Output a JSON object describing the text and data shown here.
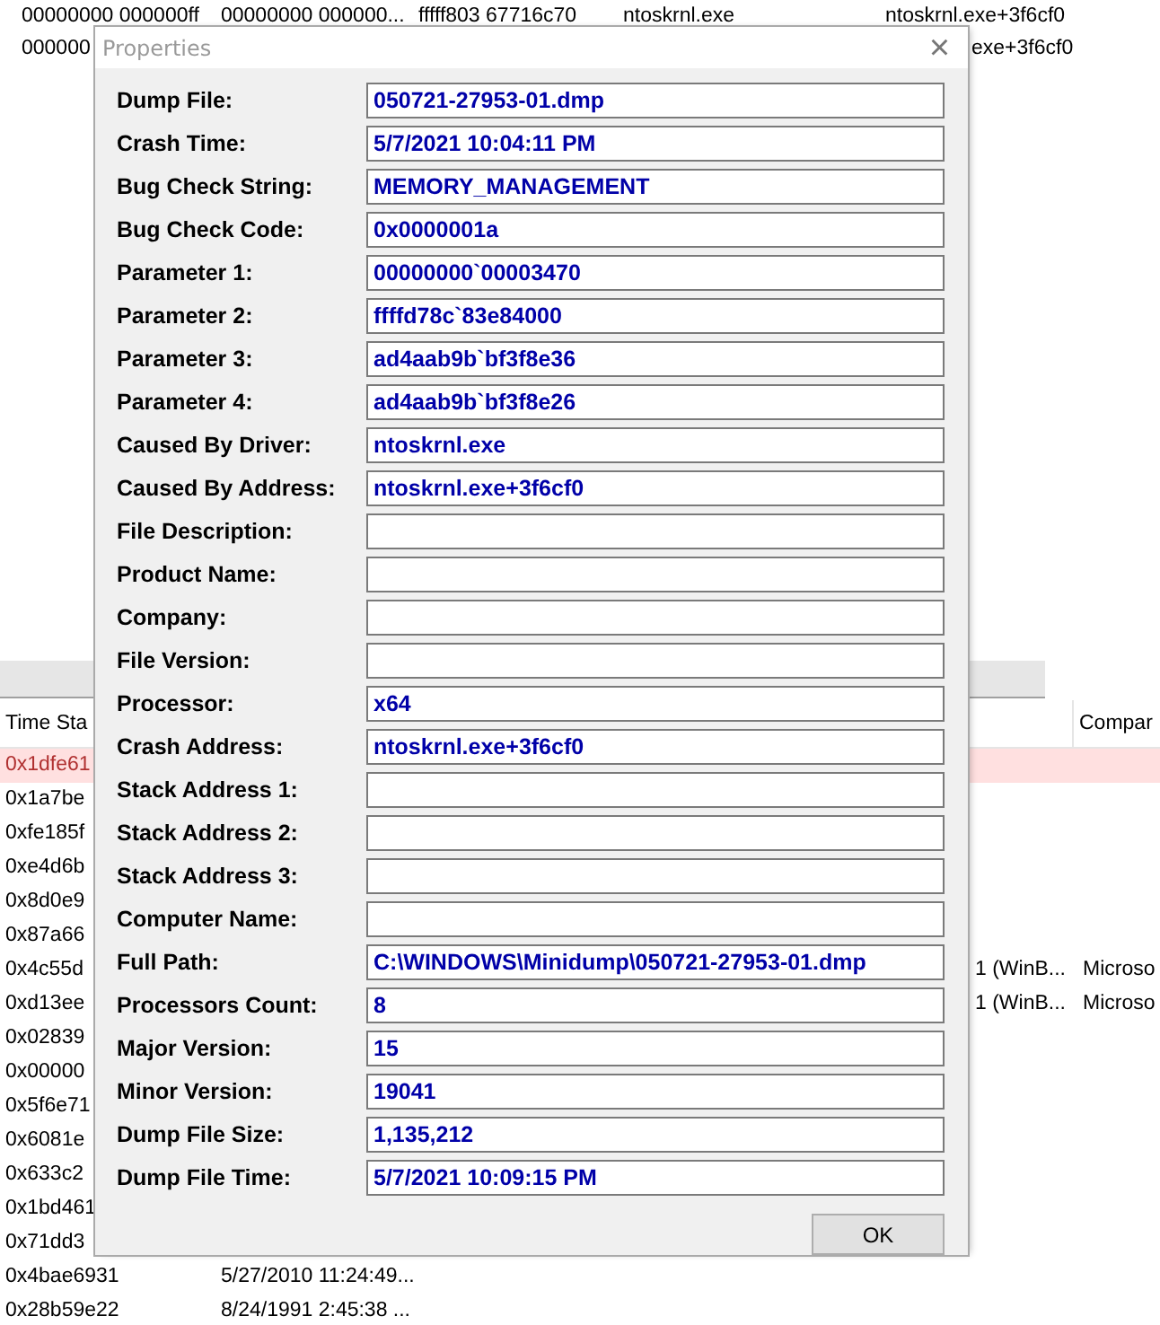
{
  "background_list": {
    "top_rows": [
      {
        "cells": [
          "00000000 000000ff",
          "00000000 000000...",
          "fffff803 67716c70",
          "ntoskrnl.exe",
          "ntoskrnl.exe+3f6cf0"
        ]
      },
      {
        "cells": [
          "000000",
          "",
          "",
          "",
          "exe+3f6cf0"
        ]
      }
    ],
    "table": {
      "visible_column_headers": [
        "Time Sta",
        "Compar"
      ],
      "rows": [
        {
          "cells": [
            "0x1dfe61",
            "",
            "",
            ""
          ],
          "selected": true
        },
        {
          "cells": [
            "0x1a7be",
            "",
            "",
            ""
          ],
          "selected": false
        },
        {
          "cells": [
            "0xfe185f",
            "",
            "",
            ""
          ],
          "selected": false
        },
        {
          "cells": [
            "0xe4d6b",
            "",
            "",
            ""
          ],
          "selected": false
        },
        {
          "cells": [
            "0x8d0e9",
            "",
            "",
            ""
          ],
          "selected": false
        },
        {
          "cells": [
            "0x87a66",
            "",
            "",
            ""
          ],
          "selected": false
        },
        {
          "cells": [
            "0x4c55d",
            "",
            "1 (WinB...",
            "Microso"
          ],
          "selected": false
        },
        {
          "cells": [
            "0xd13ee",
            "",
            "1 (WinB...",
            "Microso"
          ],
          "selected": false
        },
        {
          "cells": [
            "0x02839",
            "",
            "",
            ""
          ],
          "selected": false
        },
        {
          "cells": [
            "0x00000",
            "",
            "",
            ""
          ],
          "selected": false
        },
        {
          "cells": [
            "0x5f6e71",
            "",
            "",
            ""
          ],
          "selected": false
        },
        {
          "cells": [
            "0x6081e",
            "",
            "",
            ""
          ],
          "selected": false
        },
        {
          "cells": [
            "0x633c2",
            "",
            "",
            ""
          ],
          "selected": false
        },
        {
          "cells": [
            "0x1bd461",
            "",
            "",
            ""
          ],
          "selected": false
        },
        {
          "cells": [
            "0x71dd3",
            "",
            "",
            ""
          ],
          "selected": false
        },
        {
          "cells": [
            "0x4bae6931",
            "5/27/2010 11:24:49...",
            "",
            ""
          ],
          "selected": false
        },
        {
          "cells": [
            "0x28b59e22",
            "8/24/1991 2:45:38 ...",
            "",
            ""
          ],
          "selected": false
        }
      ]
    }
  },
  "dialog": {
    "title": "Properties",
    "close": "×",
    "fields": [
      {
        "label": "Dump File:",
        "value": "050721-27953-01.dmp"
      },
      {
        "label": "Crash Time:",
        "value": "5/7/2021 10:04:11 PM"
      },
      {
        "label": "Bug Check String:",
        "value": "MEMORY_MANAGEMENT"
      },
      {
        "label": "Bug Check Code:",
        "value": "0x0000001a"
      },
      {
        "label": "Parameter 1:",
        "value": "00000000`00003470"
      },
      {
        "label": "Parameter 2:",
        "value": "ffffd78c`83e84000"
      },
      {
        "label": "Parameter 3:",
        "value": "ad4aab9b`bf3f8e36"
      },
      {
        "label": "Parameter 4:",
        "value": "ad4aab9b`bf3f8e26"
      },
      {
        "label": "Caused By Driver:",
        "value": "ntoskrnl.exe"
      },
      {
        "label": "Caused By Address:",
        "value": "ntoskrnl.exe+3f6cf0"
      },
      {
        "label": "File Description:"
      },
      {
        "label": "Product Name:"
      },
      {
        "label": "Company:"
      },
      {
        "label": "File Version:"
      },
      {
        "label": "Processor:",
        "value": "x64"
      },
      {
        "label": "Crash Address:",
        "value": "ntoskrnl.exe+3f6cf0"
      },
      {
        "label": "Stack Address 1:"
      },
      {
        "label": "Stack Address 2:"
      },
      {
        "label": "Stack Address 3:"
      },
      {
        "label": "Computer Name:"
      },
      {
        "label": "Full Path:",
        "value": "C:\\WINDOWS\\Minidump\\050721-27953-01.dmp"
      },
      {
        "label": "Processors Count:",
        "value": "8"
      },
      {
        "label": "Major Version:",
        "value": "15"
      },
      {
        "label": "Minor Version:",
        "value": "19041"
      },
      {
        "label": "Dump File Size:",
        "value": "1,135,212"
      },
      {
        "label": "Dump File Time:",
        "value": "5/7/2021 10:09:15 PM"
      }
    ],
    "ok_button": "OK"
  }
}
